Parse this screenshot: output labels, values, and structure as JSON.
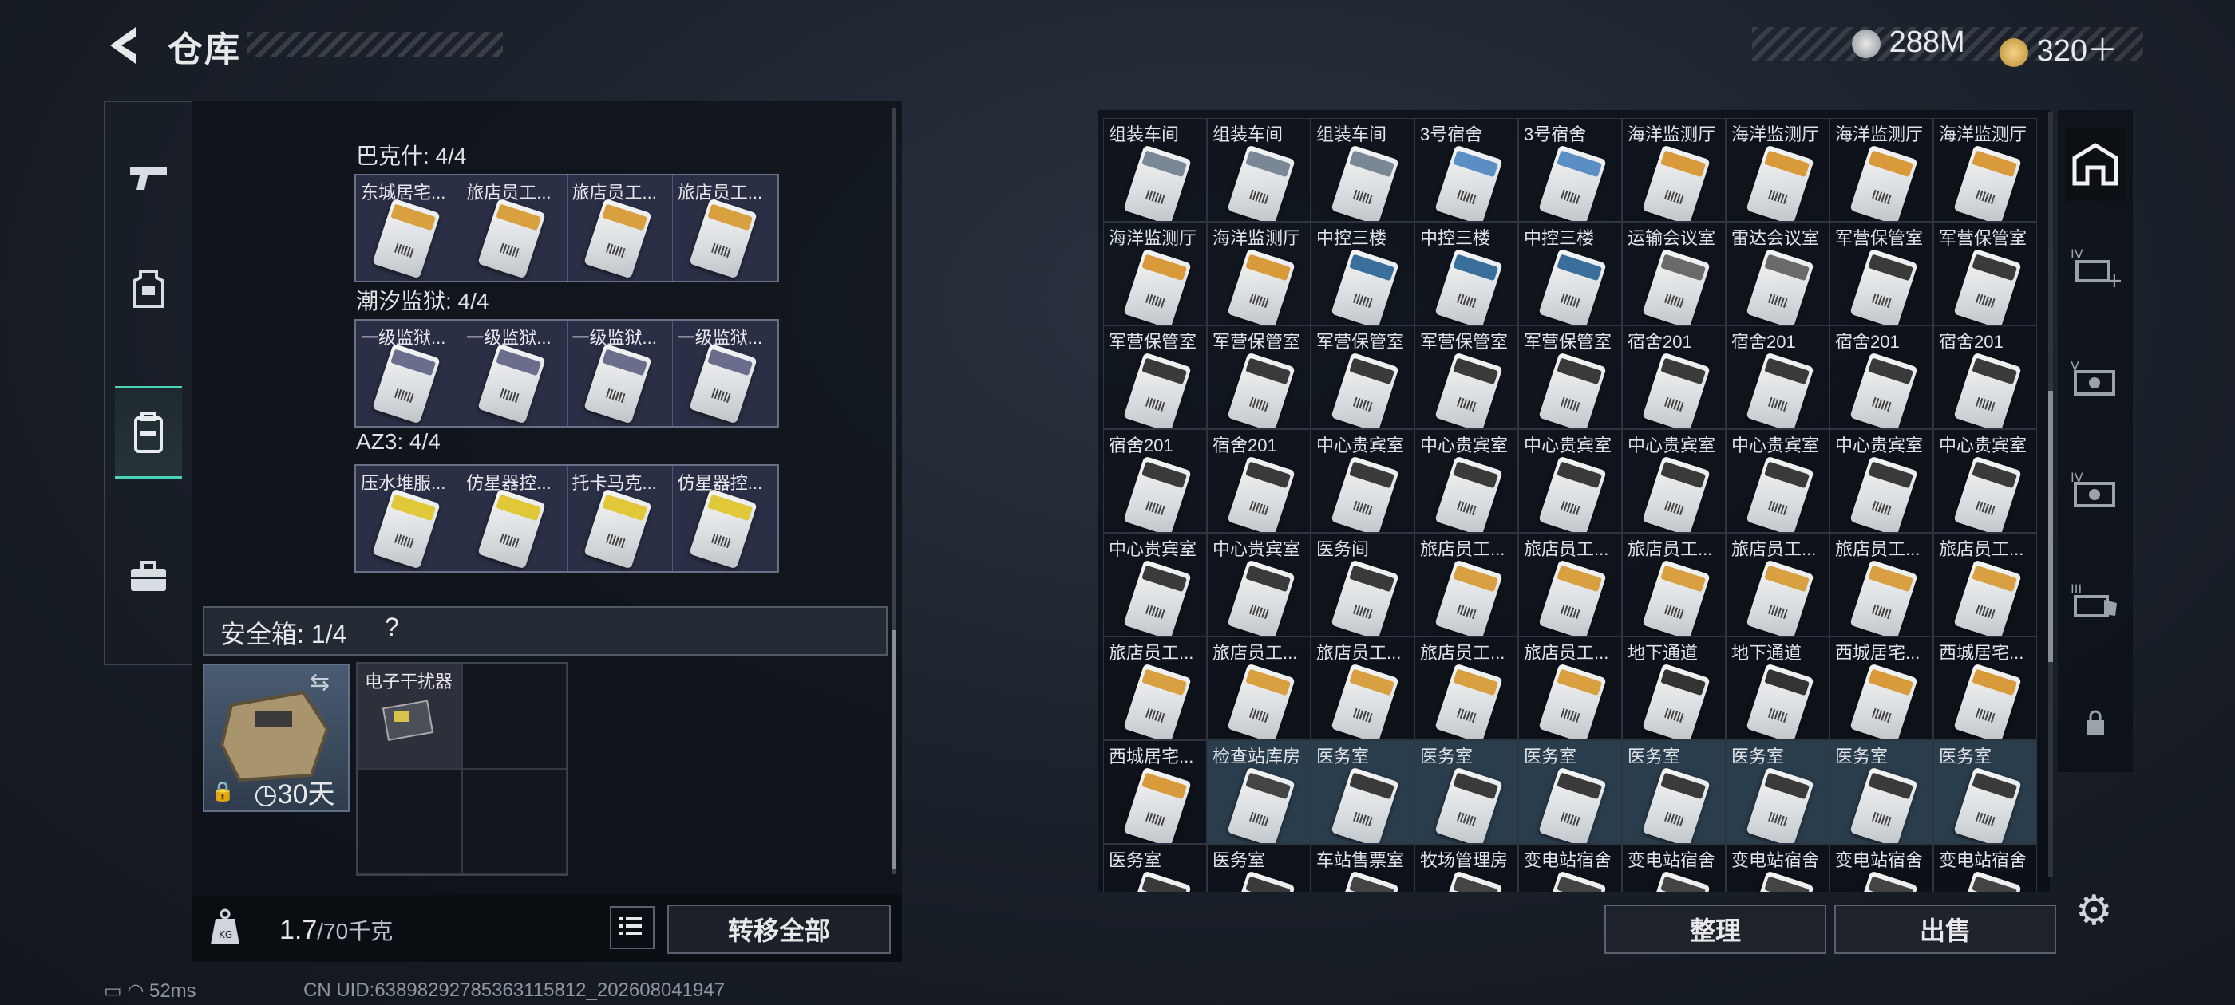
{
  "header": {
    "title": "仓库",
    "currency": [
      {
        "icon": "silver-coin-icon",
        "value": "288M"
      },
      {
        "icon": "gold-coin-icon",
        "value": "320＋"
      }
    ]
  },
  "key_groups": [
    {
      "label": "巴克什: 4/4",
      "items": [
        "东城居宅...",
        "旅店员工...",
        "旅店员工...",
        "旅店员工..."
      ],
      "strip": "#d9a040"
    },
    {
      "label": "潮汐监狱: 4/4",
      "items": [
        "一级监狱...",
        "一级监狱...",
        "一级监狱...",
        "一级监狱..."
      ],
      "strip": "#6a6e8c"
    },
    {
      "label": "AZ3: 4/4",
      "items": [
        "压水堆服...",
        "仿星器控...",
        "托卡马克...",
        "仿星器控..."
      ],
      "strip": "#e0c838"
    }
  ],
  "safe_box": {
    "label": "安全箱:",
    "count": "1/4",
    "help": "?",
    "duration": "30天",
    "item": "电子干扰器"
  },
  "weight": {
    "current": "1.7",
    "max": "/70千克"
  },
  "actions": {
    "move_all": "转移全部",
    "sort": "整理",
    "sell": "出售"
  },
  "status": {
    "ping": "52ms",
    "uid": "CN UID:6389829278536311581​2_202608041947"
  },
  "grid_items": [
    "组装车间",
    "组装车间",
    "组装车间",
    "3号宿舍",
    "3号宿舍",
    "海洋监测厅",
    "海洋监测厅",
    "海洋监测厅",
    "海洋监测厅",
    "海洋监测厅",
    "海洋监测厅",
    "中控三楼",
    "中控三楼",
    "中控三楼",
    "运输会议室",
    "雷达会议室",
    "军营保管室",
    "军营保管室",
    "军营保管室",
    "军营保管室",
    "军营保管室",
    "军营保管室",
    "军营保管室",
    "宿舍201",
    "宿舍201",
    "宿舍201",
    "宿舍201",
    "宿舍201",
    "宿舍201",
    "中心贵宾室",
    "中心贵宾室",
    "中心贵宾室",
    "中心贵宾室",
    "中心贵宾室",
    "中心贵宾室",
    "中心贵宾室",
    "中心贵宾室",
    "中心贵宾室",
    "医务间",
    "旅店员工...",
    "旅店员工...",
    "旅店员工...",
    "旅店员工...",
    "旅店员工...",
    "旅店员工...",
    "旅店员工...",
    "旅店员工...",
    "旅店员工...",
    "旅店员工...",
    "旅店员工...",
    "地下通道",
    "地下通道",
    "西城居宅...",
    "西城居宅...",
    "西城居宅...",
    "检查站库房",
    "医务室",
    "医务室",
    "医务室",
    "医务室",
    "医务室",
    "医务室",
    "医务室",
    "医务室",
    "医务室",
    "车站售票室",
    "牧场管理房",
    "变电站宿舍",
    "变电站宿舍",
    "变电站宿舍",
    "变电站宿舍",
    "变电站宿舍"
  ],
  "right_rail": [
    "building-icon",
    "lv4-add-icon",
    "lv5-room-icon",
    "lv4-room-icon",
    "lv3-room-icon",
    "lock-icon"
  ]
}
